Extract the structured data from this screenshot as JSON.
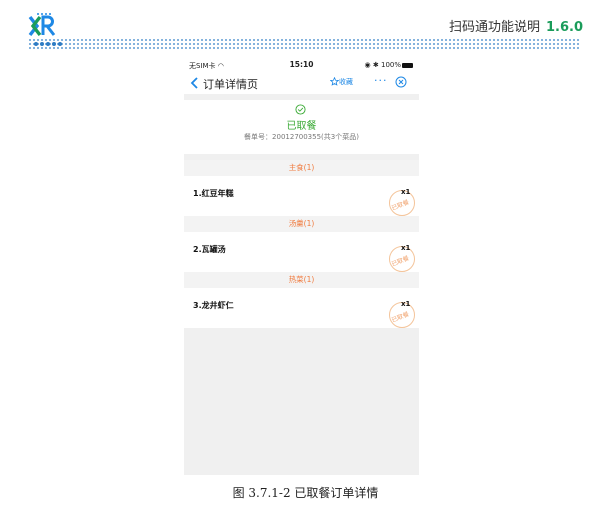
{
  "header": {
    "doc_title": "扫码通功能说明",
    "version": "1.6.0",
    "brand_color": "#1a9c5a"
  },
  "phone": {
    "status_bar": {
      "carrier": "无SIM卡",
      "time": "15:10",
      "battery": "100%"
    },
    "nav": {
      "title": "订单详情页",
      "favorite_label": "收藏",
      "more_label": "···"
    },
    "order": {
      "status": "已取餐",
      "order_number": "餐单号：20012700355(共3个菜品)",
      "status_color": "#3aaa35"
    },
    "sections": [
      {
        "category": "主食(1)",
        "item": "1.红豆年糕",
        "qty": "x1",
        "stamp": "已取餐"
      },
      {
        "category": "汤羹(1)",
        "item": "2.瓦罐汤",
        "qty": "x1",
        "stamp": "已取餐"
      },
      {
        "category": "热菜(1)",
        "item": "3.龙井虾仁",
        "qty": "x1",
        "stamp": "已取餐"
      }
    ],
    "accent_color": "#f07b3f",
    "link_color": "#1e88e5"
  },
  "caption": "图 3.7.1-2  已取餐订单详情"
}
